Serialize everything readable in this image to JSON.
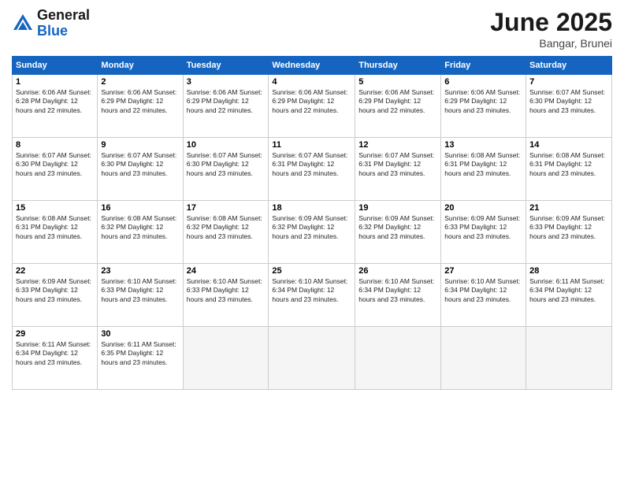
{
  "logo": {
    "line1": "General",
    "line2": "Blue"
  },
  "title": "June 2025",
  "subtitle": "Bangar, Brunei",
  "days_of_week": [
    "Sunday",
    "Monday",
    "Tuesday",
    "Wednesday",
    "Thursday",
    "Friday",
    "Saturday"
  ],
  "weeks": [
    [
      {
        "day": "1",
        "info": "Sunrise: 6:06 AM\nSunset: 6:28 PM\nDaylight: 12 hours\nand 22 minutes."
      },
      {
        "day": "2",
        "info": "Sunrise: 6:06 AM\nSunset: 6:29 PM\nDaylight: 12 hours\nand 22 minutes."
      },
      {
        "day": "3",
        "info": "Sunrise: 6:06 AM\nSunset: 6:29 PM\nDaylight: 12 hours\nand 22 minutes."
      },
      {
        "day": "4",
        "info": "Sunrise: 6:06 AM\nSunset: 6:29 PM\nDaylight: 12 hours\nand 22 minutes."
      },
      {
        "day": "5",
        "info": "Sunrise: 6:06 AM\nSunset: 6:29 PM\nDaylight: 12 hours\nand 22 minutes."
      },
      {
        "day": "6",
        "info": "Sunrise: 6:06 AM\nSunset: 6:29 PM\nDaylight: 12 hours\nand 23 minutes."
      },
      {
        "day": "7",
        "info": "Sunrise: 6:07 AM\nSunset: 6:30 PM\nDaylight: 12 hours\nand 23 minutes."
      }
    ],
    [
      {
        "day": "8",
        "info": "Sunrise: 6:07 AM\nSunset: 6:30 PM\nDaylight: 12 hours\nand 23 minutes."
      },
      {
        "day": "9",
        "info": "Sunrise: 6:07 AM\nSunset: 6:30 PM\nDaylight: 12 hours\nand 23 minutes."
      },
      {
        "day": "10",
        "info": "Sunrise: 6:07 AM\nSunset: 6:30 PM\nDaylight: 12 hours\nand 23 minutes."
      },
      {
        "day": "11",
        "info": "Sunrise: 6:07 AM\nSunset: 6:31 PM\nDaylight: 12 hours\nand 23 minutes."
      },
      {
        "day": "12",
        "info": "Sunrise: 6:07 AM\nSunset: 6:31 PM\nDaylight: 12 hours\nand 23 minutes."
      },
      {
        "day": "13",
        "info": "Sunrise: 6:08 AM\nSunset: 6:31 PM\nDaylight: 12 hours\nand 23 minutes."
      },
      {
        "day": "14",
        "info": "Sunrise: 6:08 AM\nSunset: 6:31 PM\nDaylight: 12 hours\nand 23 minutes."
      }
    ],
    [
      {
        "day": "15",
        "info": "Sunrise: 6:08 AM\nSunset: 6:31 PM\nDaylight: 12 hours\nand 23 minutes."
      },
      {
        "day": "16",
        "info": "Sunrise: 6:08 AM\nSunset: 6:32 PM\nDaylight: 12 hours\nand 23 minutes."
      },
      {
        "day": "17",
        "info": "Sunrise: 6:08 AM\nSunset: 6:32 PM\nDaylight: 12 hours\nand 23 minutes."
      },
      {
        "day": "18",
        "info": "Sunrise: 6:09 AM\nSunset: 6:32 PM\nDaylight: 12 hours\nand 23 minutes."
      },
      {
        "day": "19",
        "info": "Sunrise: 6:09 AM\nSunset: 6:32 PM\nDaylight: 12 hours\nand 23 minutes."
      },
      {
        "day": "20",
        "info": "Sunrise: 6:09 AM\nSunset: 6:33 PM\nDaylight: 12 hours\nand 23 minutes."
      },
      {
        "day": "21",
        "info": "Sunrise: 6:09 AM\nSunset: 6:33 PM\nDaylight: 12 hours\nand 23 minutes."
      }
    ],
    [
      {
        "day": "22",
        "info": "Sunrise: 6:09 AM\nSunset: 6:33 PM\nDaylight: 12 hours\nand 23 minutes."
      },
      {
        "day": "23",
        "info": "Sunrise: 6:10 AM\nSunset: 6:33 PM\nDaylight: 12 hours\nand 23 minutes."
      },
      {
        "day": "24",
        "info": "Sunrise: 6:10 AM\nSunset: 6:33 PM\nDaylight: 12 hours\nand 23 minutes."
      },
      {
        "day": "25",
        "info": "Sunrise: 6:10 AM\nSunset: 6:34 PM\nDaylight: 12 hours\nand 23 minutes."
      },
      {
        "day": "26",
        "info": "Sunrise: 6:10 AM\nSunset: 6:34 PM\nDaylight: 12 hours\nand 23 minutes."
      },
      {
        "day": "27",
        "info": "Sunrise: 6:10 AM\nSunset: 6:34 PM\nDaylight: 12 hours\nand 23 minutes."
      },
      {
        "day": "28",
        "info": "Sunrise: 6:11 AM\nSunset: 6:34 PM\nDaylight: 12 hours\nand 23 minutes."
      }
    ],
    [
      {
        "day": "29",
        "info": "Sunrise: 6:11 AM\nSunset: 6:34 PM\nDaylight: 12 hours\nand 23 minutes."
      },
      {
        "day": "30",
        "info": "Sunrise: 6:11 AM\nSunset: 6:35 PM\nDaylight: 12 hours\nand 23 minutes."
      },
      {
        "day": "",
        "info": ""
      },
      {
        "day": "",
        "info": ""
      },
      {
        "day": "",
        "info": ""
      },
      {
        "day": "",
        "info": ""
      },
      {
        "day": "",
        "info": ""
      }
    ]
  ]
}
